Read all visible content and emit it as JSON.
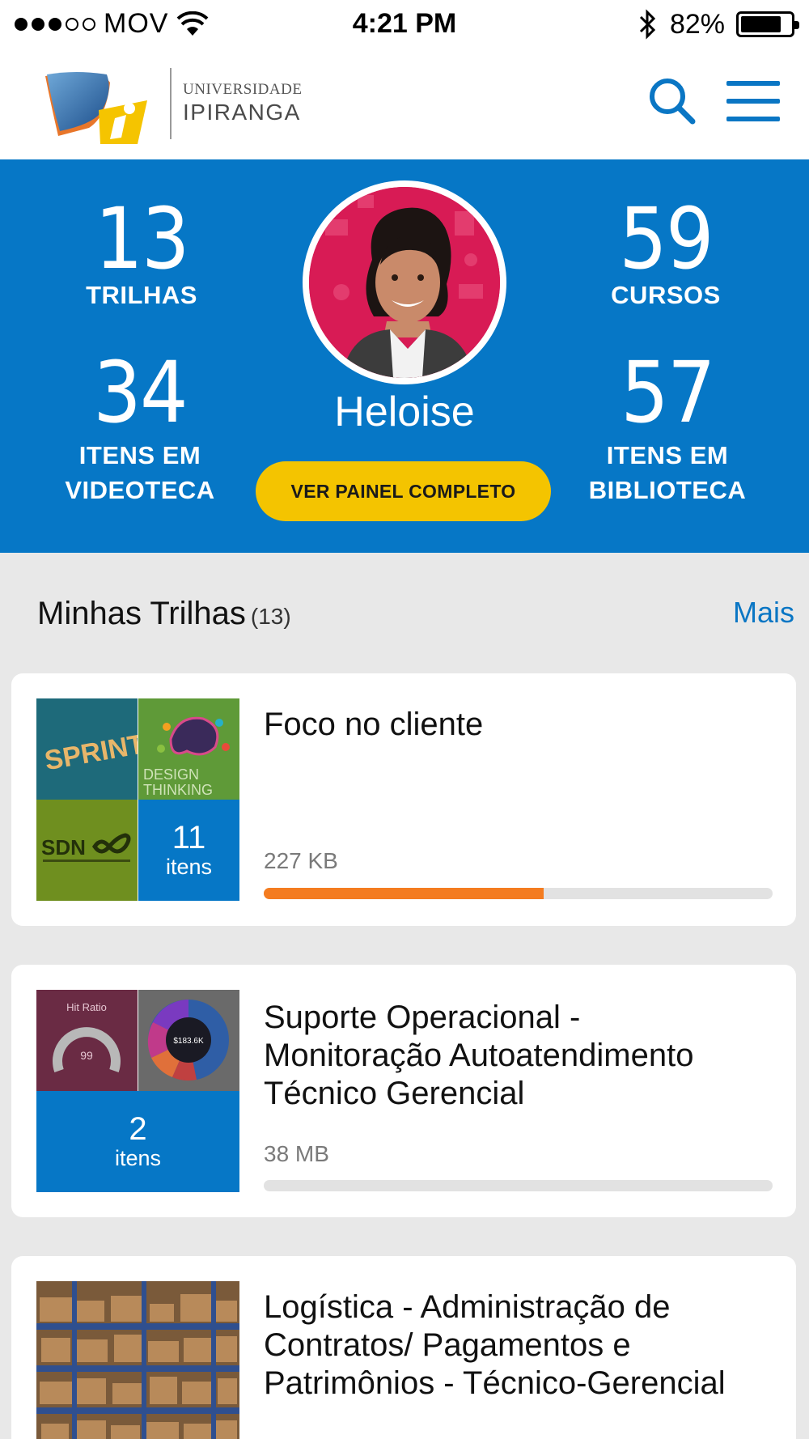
{
  "status_bar": {
    "carrier": "MOV",
    "time": "4:21 PM",
    "battery_percent": "82%",
    "battery_level": 0.82
  },
  "header": {
    "logo_line1": "UNIVERSIDADE",
    "logo_line2": "IPIRANGA",
    "search_icon": "search-icon",
    "menu_icon": "hamburger-menu-icon",
    "accent_color": "#0a76c4"
  },
  "profile": {
    "name": "Heloise",
    "cta_label": "VER PAINEL COMPLETO",
    "panel_color": "#0677c6",
    "cta_color": "#f4c400",
    "stats": {
      "trilhas": {
        "value": "13",
        "label": "TRILHAS"
      },
      "cursos": {
        "value": "59",
        "label": "CURSOS"
      },
      "videoteca": {
        "value": "34",
        "label_line1": "ITENS EM",
        "label_line2": "VIDEOTECA"
      },
      "biblioteca": {
        "value": "57",
        "label_line1": "ITENS EM",
        "label_line2": "BIBLIOTECA"
      }
    }
  },
  "section": {
    "title": "Minhas Trilhas",
    "count": "(13)",
    "more_label": "Mais"
  },
  "cards": [
    {
      "title": "Foco no cliente",
      "size": "227 KB",
      "items_count": "11",
      "items_word": "itens",
      "progress": 0.55,
      "thumb_labels": {
        "sprint": "SPRINT",
        "design1": "DESIGN",
        "design2": "THINKING",
        "sdn": "SDN"
      }
    },
    {
      "title_line1": "Suporte Operacional -",
      "title_line2": "Monitoração Autoatendimento",
      "title_line3": "Técnico Gerencial",
      "size": "38 MB",
      "items_count": "2",
      "items_word": "itens",
      "progress": 0,
      "thumb_labels": {
        "gauge_title": "Hit Ratio",
        "gauge_value": "99",
        "donut_value": "$183.6K"
      }
    },
    {
      "title_line1": "Logística - Administração de",
      "title_line2": "Contratos/ Pagamentos e",
      "title_line3": "Patrimônios - Técnico-Gerencial"
    }
  ],
  "progress_color": "#f47c20"
}
